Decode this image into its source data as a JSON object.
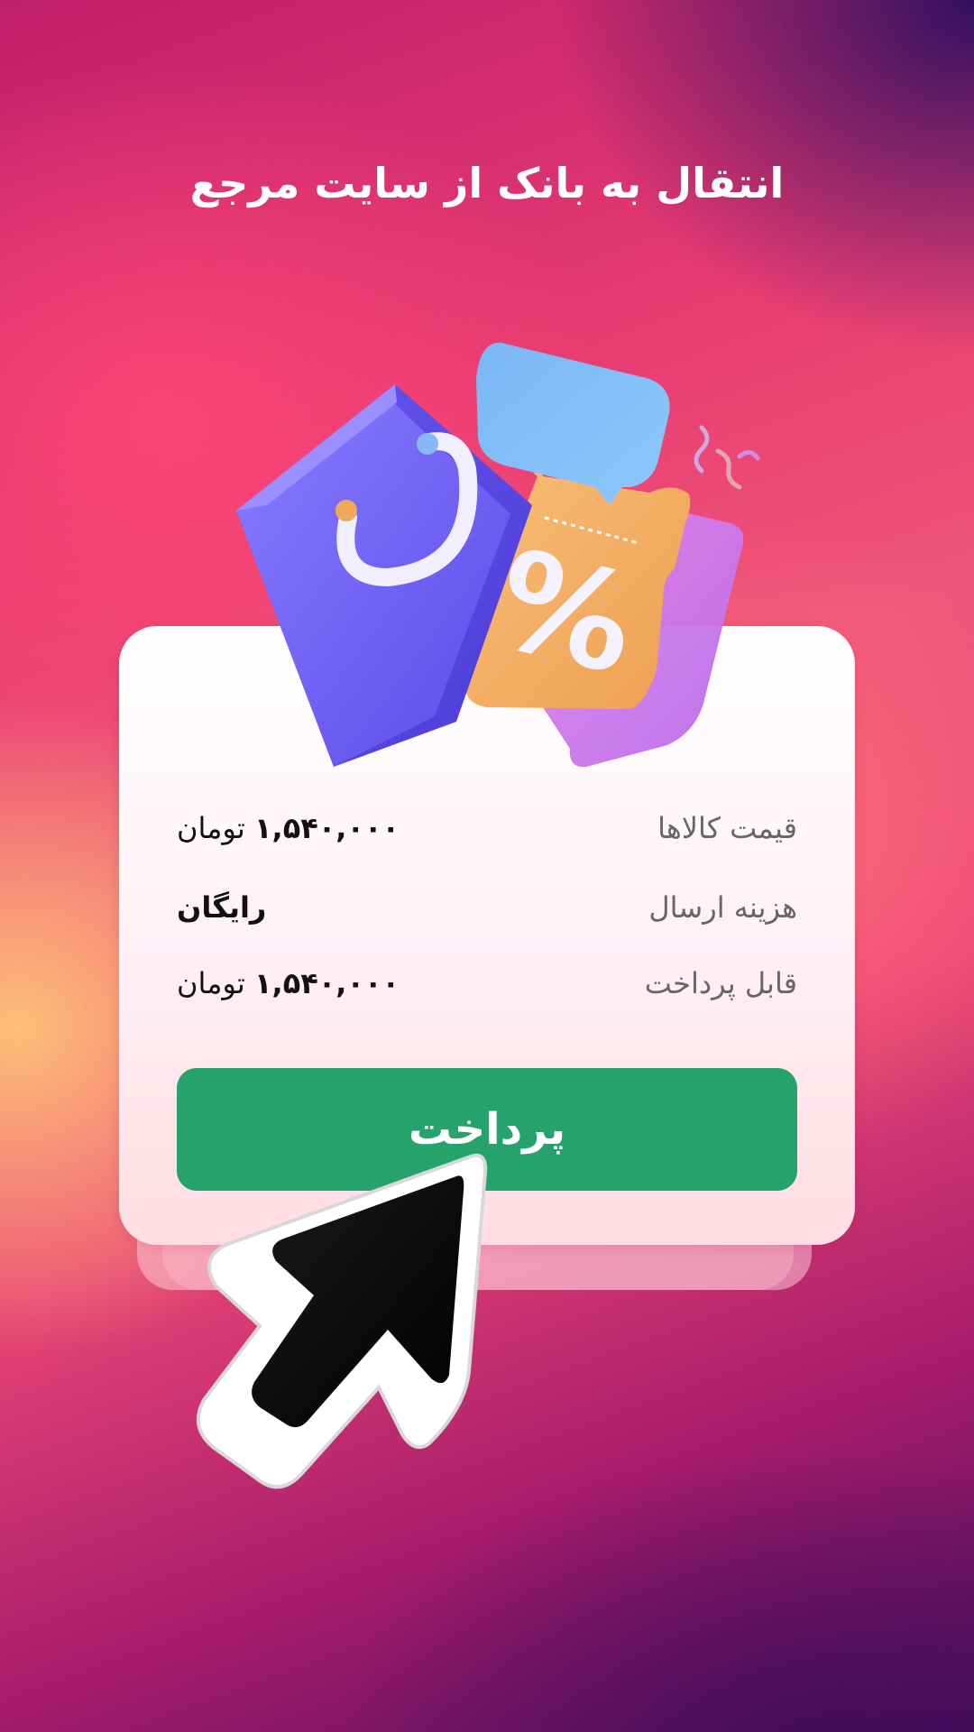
{
  "header": {
    "title": "انتقال به بانک از سایت مرجع"
  },
  "summary": {
    "rows": [
      {
        "label": "قیمت کالاها",
        "amount": "۱,۵۴۰,۰۰۰",
        "unit": "تومان"
      },
      {
        "label": "هزینه ارسال",
        "amount": "رایگان",
        "unit": ""
      },
      {
        "label": "قابل پرداخت",
        "amount": "۱,۵۴۰,۰۰۰",
        "unit": "تومان"
      }
    ]
  },
  "actions": {
    "pay_label": "پرداخت"
  },
  "illustration": {
    "icons": [
      "shopping-bag-icon",
      "discount-coupon-icon",
      "chat-bubble-icon",
      "confetti-icon",
      "mouse-cursor-icon"
    ],
    "coupon_symbol": "%"
  },
  "colors": {
    "pay_button": "#26a36c",
    "bag": "#7a6af5",
    "coupon": "#f5b264",
    "chat_bubble": "#7fbdf7",
    "card_background": "#ffffff"
  }
}
